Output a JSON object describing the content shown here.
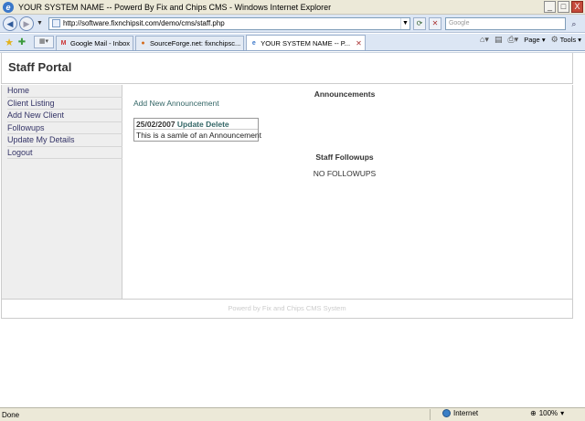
{
  "window": {
    "title": "YOUR SYSTEM NAME -- Powerd By Fix and Chips CMS - Windows Internet Explorer",
    "minimize": "_",
    "restore": "□",
    "close": "X"
  },
  "address_bar": {
    "url": "http://software.fixnchipsit.com/demo/cms/staff.php",
    "search_placeholder": "Google"
  },
  "tabs": [
    {
      "label": "Google Mail - Inbox",
      "icon": "M"
    },
    {
      "label": "SourceForge.net: fixnchipsc...",
      "icon": "●"
    },
    {
      "label": "YOUR SYSTEM NAME -- P...",
      "icon": "e"
    }
  ],
  "toolbar": {
    "page_label": "Page",
    "tools_label": "Tools"
  },
  "portal": {
    "title": "Staff Portal",
    "sidebar": [
      {
        "label": "Home"
      },
      {
        "label": "Client Listing"
      },
      {
        "label": "Add New Client"
      },
      {
        "label": "Followups"
      },
      {
        "label": "Update My Details"
      },
      {
        "label": "Logout"
      }
    ],
    "announcements_heading": "Announcements",
    "add_announcement_link": "Add New Announcement",
    "announcement": {
      "date": "25/02/2007",
      "update_label": "Update",
      "delete_label": "Delete",
      "text": "This is a samle of an Announcement"
    },
    "followups_heading": "Staff Followups",
    "no_followups": "NO FOLLOWUPS",
    "footer": "Powerd by Fix and Chips CMS System"
  },
  "statusbar": {
    "status": "Done",
    "zone": "Internet",
    "zoom": "100%"
  }
}
